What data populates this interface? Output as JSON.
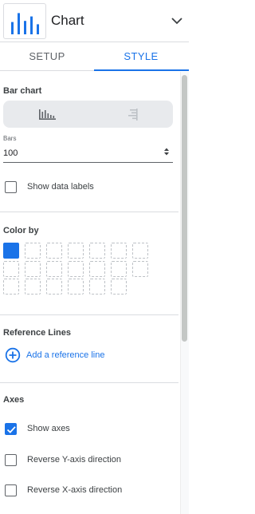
{
  "header": {
    "title": "Chart",
    "chart_icon": "bar-chart-icon",
    "menu_icon": "chevron-down-icon",
    "thumb_bar_fractions": [
      0.55,
      0.95,
      0.6,
      0.8,
      0.45
    ]
  },
  "tabs": [
    {
      "label": "SETUP",
      "active": false
    },
    {
      "label": "STYLE",
      "active": true
    }
  ],
  "colors": {
    "accent": "#1a73e8",
    "text": "#202124",
    "muted": "#5f6368",
    "divider": "#dadce0",
    "segment_bg": "#e8eaed"
  },
  "bar_chart": {
    "title": "Bar chart",
    "orientation_options": [
      {
        "icon": "vertical-bars-icon",
        "selected": true
      },
      {
        "icon": "horizontal-bars-icon",
        "selected": false
      }
    ],
    "bars_label": "Bars",
    "bars_value": "100",
    "show_data_labels": {
      "label": "Show data labels",
      "checked": false
    }
  },
  "color_by": {
    "title": "Color by",
    "swatches_total": 20,
    "selected_index": 0
  },
  "reference_lines": {
    "title": "Reference Lines",
    "add_label": "Add a reference line",
    "add_icon": "add-circle-icon"
  },
  "axes": {
    "title": "Axes",
    "options": [
      {
        "label": "Show axes",
        "checked": true
      },
      {
        "label": "Reverse Y-axis direction",
        "checked": false
      },
      {
        "label": "Reverse X-axis direction",
        "checked": false
      }
    ]
  }
}
